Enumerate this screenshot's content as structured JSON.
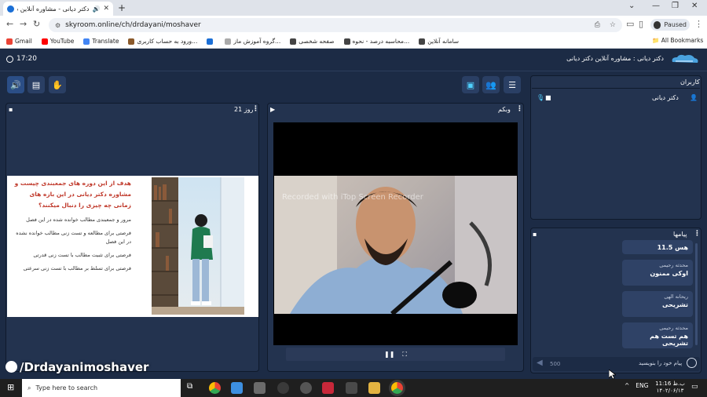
{
  "browser": {
    "tab_title": "دکتر دیانی - مشاوره آنلاین دکت...",
    "url": "skyroom.online/ch/drdayani/moshaver",
    "profile_label": "Paused",
    "bookmarks": [
      {
        "label": "Gmail",
        "color": "#ea4335"
      },
      {
        "label": "YouTube",
        "color": "#ff0000"
      },
      {
        "label": "Translate",
        "color": "#4285f4"
      },
      {
        "label": "ورود به حساب کاربری...",
        "color": "#8b5a2b"
      },
      {
        "label": "",
        "color": "#1b6fd6"
      },
      {
        "label": "گروه آموزش ماز...",
        "color": "#aaaaaa"
      },
      {
        "label": "صفحه شخصی",
        "color": "#444444"
      },
      {
        "label": "محاسبه درصد - نحوه...",
        "color": "#444444"
      },
      {
        "label": "سامانه آنلاین",
        "color": "#444444"
      }
    ],
    "all_bookmarks": "All Bookmarks"
  },
  "app": {
    "time": "17:20",
    "title": "دکتر دیانی : مشاوره آنلاین دکتر دیانی"
  },
  "slide_panel": {
    "title": "21 روز",
    "heading": "هدف از این دوره های جمعبندی چیست و مشاوره دکتر دیانی در این بازه های زمانی چه چیزی را دنبال میکنند؟",
    "lines": [
      "مرور و جمعبندی مطالب خوانده شده در این فصل",
      "فرصتی برای مطالعه و تست زنی مطالب خوانده نشده در این فصل",
      "فرصتی برای تثبیت مطالب با تست زنی قدرتی",
      "فرصتی برای تسلط بر مطالب با تست زنی سرعتی"
    ],
    "watermark": "/Drdayanimoshaver"
  },
  "camera_panel": {
    "title": "وبکم",
    "overlay": "Recorded with iTop Screen Recorder"
  },
  "users_panel": {
    "title": "کاربران",
    "users": [
      {
        "name": "دکتر دیانی"
      }
    ]
  },
  "chat_panel": {
    "title": "پیامها",
    "messages": [
      {
        "sender": "",
        "text": "11.5 هس"
      },
      {
        "sender": "محدثه رحیمی",
        "text": "اوکی ممنون"
      },
      {
        "sender": "ریحانه الهی",
        "text": "تشریحی"
      },
      {
        "sender": "محدثه رحیمی",
        "text": "هم تست هم تشریحی"
      }
    ],
    "input_placeholder": "پیام خود را بنویسید",
    "char_limit": "500"
  },
  "taskbar": {
    "search_placeholder": "Type here to search",
    "lang": "ENG",
    "time": "11:16 ب.ظ",
    "date": "۱۴۰۲/۰۶/۱۳"
  },
  "colors": {
    "app_bg": "#1c2b45",
    "panel_bg": "#23334f",
    "accent": "#4fd1ff"
  }
}
